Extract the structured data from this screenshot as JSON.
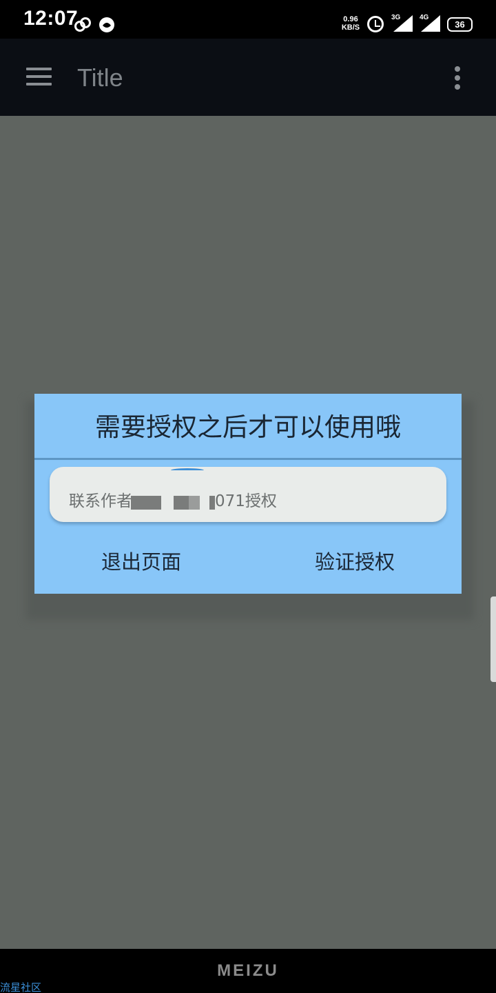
{
  "status_bar": {
    "time": "12:07",
    "net_speed_value": "0.96",
    "net_speed_unit": "KB/S",
    "signal_1_type": "3G",
    "signal_2_type": "4G",
    "battery": "36",
    "icons": [
      "link-icon",
      "notification-icon",
      "alarm-icon",
      "signal-3g-icon",
      "signal-4g-icon",
      "battery-icon"
    ]
  },
  "app_bar": {
    "title": "Title",
    "menu_icon": "hamburger-menu-icon",
    "more_icon": "more-vert-icon"
  },
  "dialog": {
    "title": "需要授权之后才可以使用哦",
    "input_visible_prefix": "联系作者",
    "input_visible_suffix": "071授权",
    "negative_button": "退出页面",
    "positive_button": "验证授权"
  },
  "nav_bar": {
    "brand": "MEIZU"
  },
  "watermark": "流星社区",
  "colors": {
    "dialog_background": "#88c6f8",
    "app_bar_background": "#0b0e14",
    "scrim": "#5f6460"
  }
}
